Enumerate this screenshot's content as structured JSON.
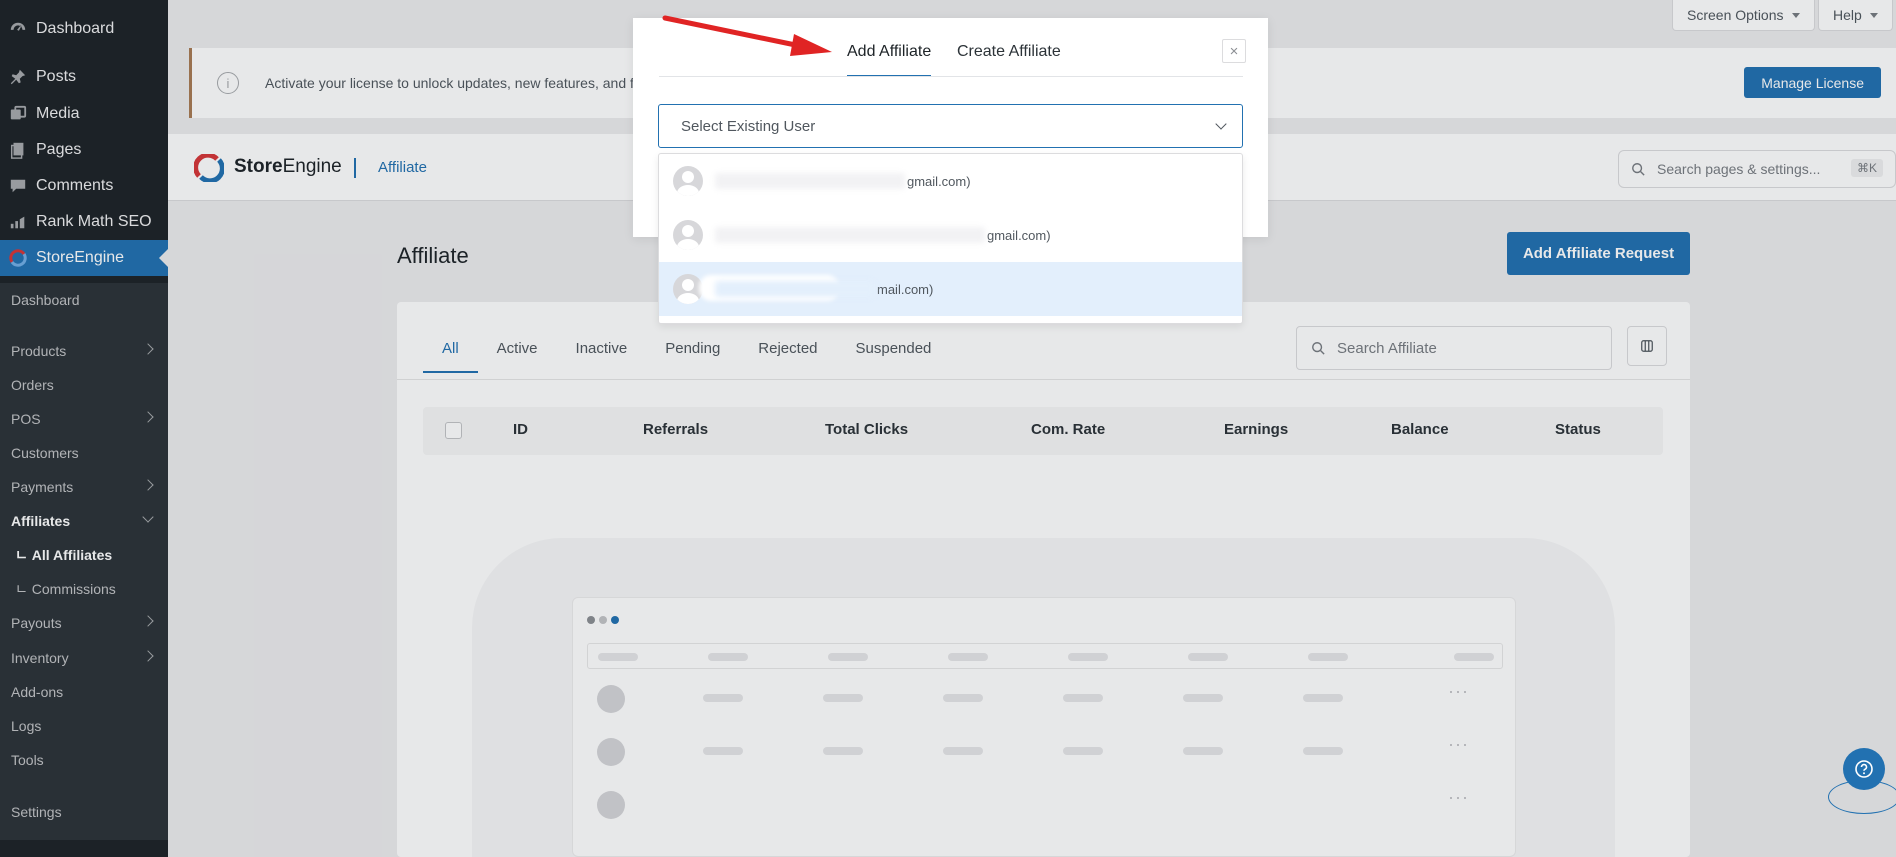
{
  "sidebar": {
    "top_items": [
      {
        "label": "Dashboard",
        "icon": "dashboard-icon"
      },
      {
        "label": "Posts",
        "icon": "pin-icon"
      },
      {
        "label": "Media",
        "icon": "media-icon"
      },
      {
        "label": "Pages",
        "icon": "pages-icon"
      },
      {
        "label": "Comments",
        "icon": "comment-icon"
      },
      {
        "label": "Rank Math SEO",
        "icon": "rankmath-icon"
      },
      {
        "label": "StoreEngine",
        "icon": "storeengine-icon"
      }
    ],
    "sub_items": [
      {
        "label": "Dashboard"
      },
      {
        "label": "Products"
      },
      {
        "label": "Orders"
      },
      {
        "label": "POS"
      },
      {
        "label": "Customers"
      },
      {
        "label": "Payments"
      },
      {
        "label": "Affiliates"
      },
      {
        "label": "ㄴ All Affiliates"
      },
      {
        "label": "ㄴ Commissions"
      },
      {
        "label": "Payouts"
      },
      {
        "label": "Inventory"
      },
      {
        "label": "Add-ons"
      },
      {
        "label": "Logs"
      },
      {
        "label": "Tools"
      },
      {
        "label": "Settings"
      }
    ]
  },
  "topbar": {
    "screen_options": "Screen Options",
    "help": "Help"
  },
  "notice": {
    "text": "Activate your license to unlock updates, new features, and fu",
    "button": "Manage License"
  },
  "header": {
    "brand_bold": "Store",
    "brand_rest": "Engine",
    "breadcrumb": "Affiliate",
    "search_placeholder": "Search pages & settings...",
    "shortcut": "⌘K"
  },
  "page": {
    "title": "Affiliate",
    "add_button": "Add Affiliate Request"
  },
  "filters": {
    "tabs": [
      "All",
      "Active",
      "Inactive",
      "Pending",
      "Rejected",
      "Suspended"
    ],
    "active": "All",
    "search_placeholder": "Search Affiliate"
  },
  "table": {
    "columns": [
      "ID",
      "Referrals",
      "Total Clicks",
      "Com. Rate",
      "Earnings",
      "Balance",
      "Status"
    ]
  },
  "modal": {
    "tabs": [
      "Add Affiliate",
      "Create Affiliate"
    ],
    "active_tab": "Add Affiliate",
    "close": "×",
    "select_placeholder": "Select Existing User",
    "options": [
      {
        "visible_text": "gmail.com)"
      },
      {
        "visible_text": "gmail.com)"
      },
      {
        "visible_text": "mail.com)"
      }
    ]
  },
  "colors": {
    "accent": "#2271b1",
    "sidebar_bg": "#1d2327",
    "submenu_bg": "#2c3338",
    "highlight": "#e3effc",
    "arrow": "#e02424"
  }
}
